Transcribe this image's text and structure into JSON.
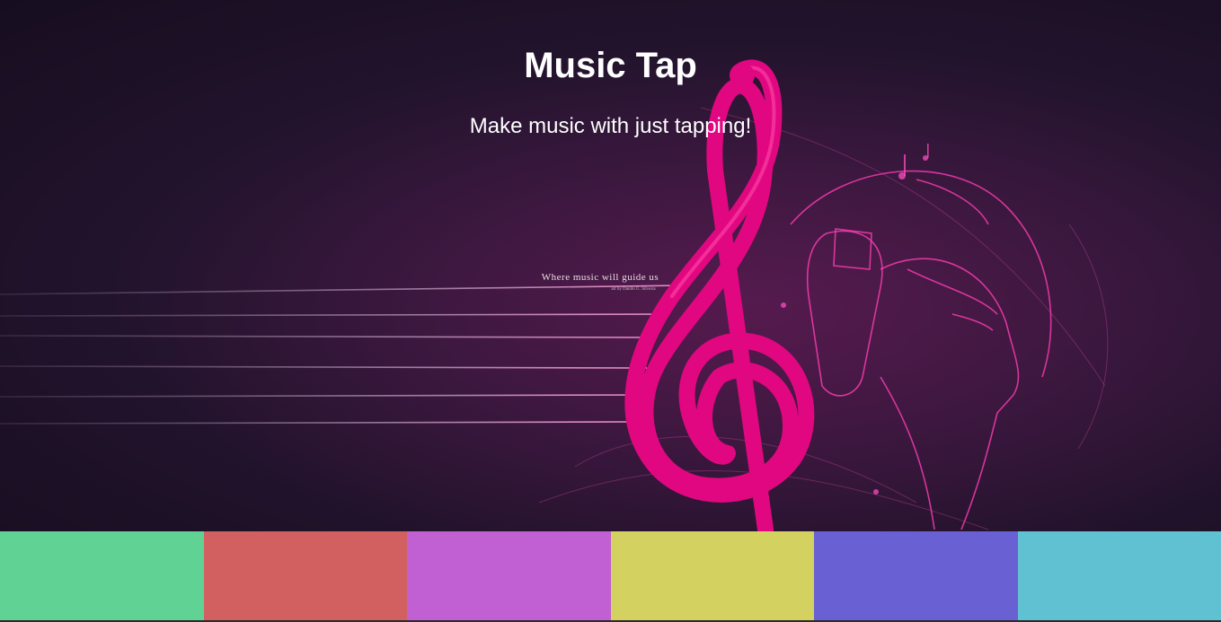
{
  "header": {
    "title": "Music Tap",
    "subtitle": "Make music with just tapping!"
  },
  "artwork": {
    "caption": "Where music will guide us",
    "credit": "art by Danilo G. Silveira"
  },
  "pads": [
    {
      "name": "pad-1",
      "color": "#60d394"
    },
    {
      "name": "pad-2",
      "color": "#d36060"
    },
    {
      "name": "pad-3",
      "color": "#c060d3"
    },
    {
      "name": "pad-4",
      "color": "#d3d160"
    },
    {
      "name": "pad-5",
      "color": "#6860d3"
    },
    {
      "name": "pad-6",
      "color": "#60c1d3"
    }
  ]
}
